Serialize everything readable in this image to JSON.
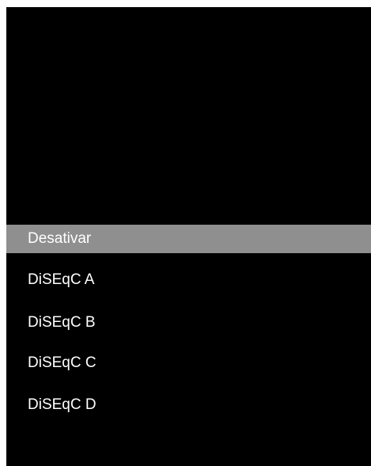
{
  "menu": {
    "options": [
      {
        "label": "Desativar",
        "selected": true
      },
      {
        "label": "DiSEqC A",
        "selected": false
      },
      {
        "label": "DiSEqC B",
        "selected": false
      },
      {
        "label": "DiSEqC C",
        "selected": false
      },
      {
        "label": "DiSEqC D",
        "selected": false
      }
    ],
    "colors": {
      "background": "#000000",
      "selected_highlight": "#8f8f8f",
      "text": "#ffffff",
      "frame": "#ffffff"
    }
  }
}
